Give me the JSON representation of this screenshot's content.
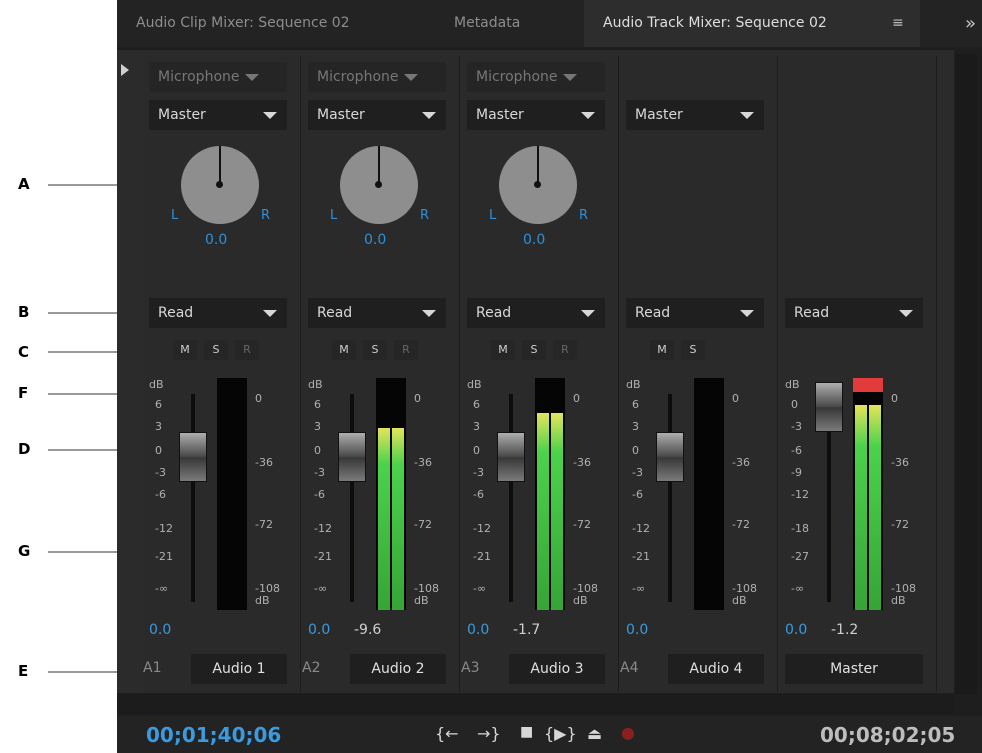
{
  "annotations": [
    "A",
    "B",
    "C",
    "F",
    "D",
    "G",
    "E"
  ],
  "tabs": {
    "clip_mixer": "Audio Clip Mixer: Sequence 02",
    "metadata": "Metadata",
    "track_mixer": "Audio Track Mixer: Sequence 02",
    "menu_icon": "≡",
    "overflow_icon": "»"
  },
  "scale_labels": {
    "left": [
      "dB",
      "6",
      "3",
      "0",
      "-3",
      "-6",
      "-12",
      "-21",
      "-∞"
    ],
    "master_left": [
      "dB",
      "0",
      "-3",
      "-6",
      "-9",
      "-12",
      "-18",
      "-27",
      "-∞"
    ],
    "right": [
      "0",
      "-36",
      "-72",
      "-108",
      "dB"
    ]
  },
  "tracks": [
    {
      "input": "Microphone",
      "output": "Master",
      "pan": "0.0",
      "L": "L",
      "R": "R",
      "automation": "Read",
      "mute": "M",
      "solo": "S",
      "record": "R",
      "volume": "0.0",
      "peak": "",
      "track_num": "A1",
      "name": "Audio 1",
      "level": 0.0
    },
    {
      "input": "Microphone",
      "output": "Master",
      "pan": "0.0",
      "L": "L",
      "R": "R",
      "automation": "Read",
      "mute": "M",
      "solo": "S",
      "record": "R",
      "volume": "0.0",
      "peak": "-9.6",
      "track_num": "A2",
      "name": "Audio 2",
      "level": 0.85
    },
    {
      "input": "Microphone",
      "output": "Master",
      "pan": "0.0",
      "L": "L",
      "R": "R",
      "automation": "Read",
      "mute": "M",
      "solo": "S",
      "record": "R",
      "volume": "0.0",
      "peak": "-1.7",
      "track_num": "A3",
      "name": "Audio 3",
      "level": 0.92
    },
    {
      "input": "",
      "output": "Master",
      "pan": "",
      "L": "",
      "R": "",
      "automation": "Read",
      "mute": "M",
      "solo": "S",
      "record": "",
      "volume": "0.0",
      "peak": "",
      "track_num": "A4",
      "name": "Audio 4",
      "level": 0.0
    },
    {
      "input": "",
      "output": "",
      "pan": "",
      "L": "",
      "R": "",
      "automation": "Read",
      "mute": "",
      "solo": "",
      "record": "",
      "volume": "0.0",
      "peak": "-1.2",
      "track_num": "",
      "name": "Master",
      "level": 0.96
    }
  ],
  "transport": {
    "current_time": "00;01;40;06",
    "duration": "00;08;02;05",
    "go_in": "{←",
    "go_out": "→}",
    "stop": "■",
    "play_in_out": "{▶}",
    "loop": "⏏",
    "record": "●"
  },
  "colors": {
    "accent": "#3b9be0",
    "meter_green": "#4bd24b",
    "clip_red": "#e23b3b"
  }
}
